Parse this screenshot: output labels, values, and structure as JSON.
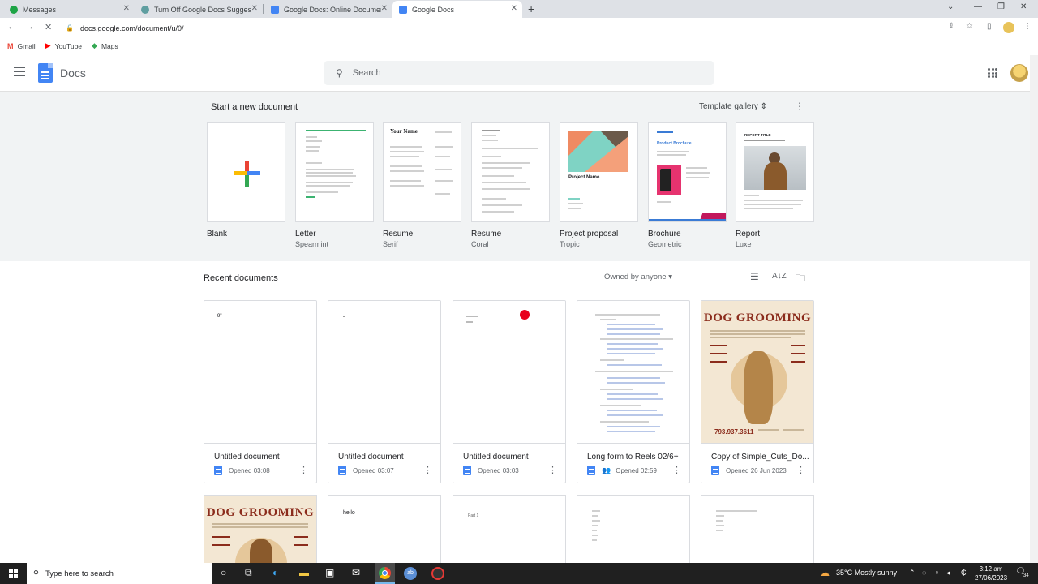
{
  "browser": {
    "tabs": [
      {
        "title": "Messages",
        "color": "#1ea446"
      },
      {
        "title": "Turn Off Google Docs Suggestio",
        "color": "#5f9ea0"
      },
      {
        "title": "Google Docs: Online Document",
        "color": "#4285f4"
      },
      {
        "title": "Google Docs",
        "color": "#4285f4"
      }
    ],
    "url": "docs.google.com/document/u/0/",
    "bookmarks": [
      "Gmail",
      "YouTube",
      "Maps"
    ]
  },
  "header": {
    "app_name": "Docs",
    "search_placeholder": "Search"
  },
  "templates": {
    "heading": "Start a new document",
    "gallery_label": "Template gallery",
    "items": [
      {
        "name": "Blank",
        "sub": ""
      },
      {
        "name": "Letter",
        "sub": "Spearmint"
      },
      {
        "name": "Resume",
        "sub": "Serif"
      },
      {
        "name": "Resume",
        "sub": "Coral"
      },
      {
        "name": "Project proposal",
        "sub": "Tropic"
      },
      {
        "name": "Brochure",
        "sub": "Geometric"
      },
      {
        "name": "Report",
        "sub": "Luxe"
      }
    ],
    "resume_heading": "Your Name",
    "project_heading": "Project Name",
    "brochure_heading": "Product Brochure",
    "report_heading": "REPORT TITLE"
  },
  "recent": {
    "heading": "Recent documents",
    "owner_filter": "Owned by anyone",
    "docs": [
      {
        "title": "Untitled document",
        "opened": "Opened 03:08",
        "preview": "9\""
      },
      {
        "title": "Untitled document",
        "opened": "Opened 03:07",
        "preview": ""
      },
      {
        "title": "Untitled document",
        "opened": "Opened 03:03",
        "preview": ""
      },
      {
        "title": "Long form to Reels 02/6+",
        "opened": "Opened 02:59",
        "preview": ""
      },
      {
        "title": "Copy of Simple_Cuts_Do...",
        "opened": "Opened 26 Jun 2023",
        "preview": ""
      }
    ],
    "poster_title": "DOG GROOMING",
    "poster_phone": "793.937.3611",
    "row2_previews": [
      "",
      "hello",
      "Part 1",
      "",
      ""
    ]
  },
  "taskbar": {
    "search_placeholder": "Type here to search",
    "weather": "35°C  Mostly sunny",
    "time": "3:12 am",
    "date": "27/06/2023",
    "notifications": "34"
  }
}
